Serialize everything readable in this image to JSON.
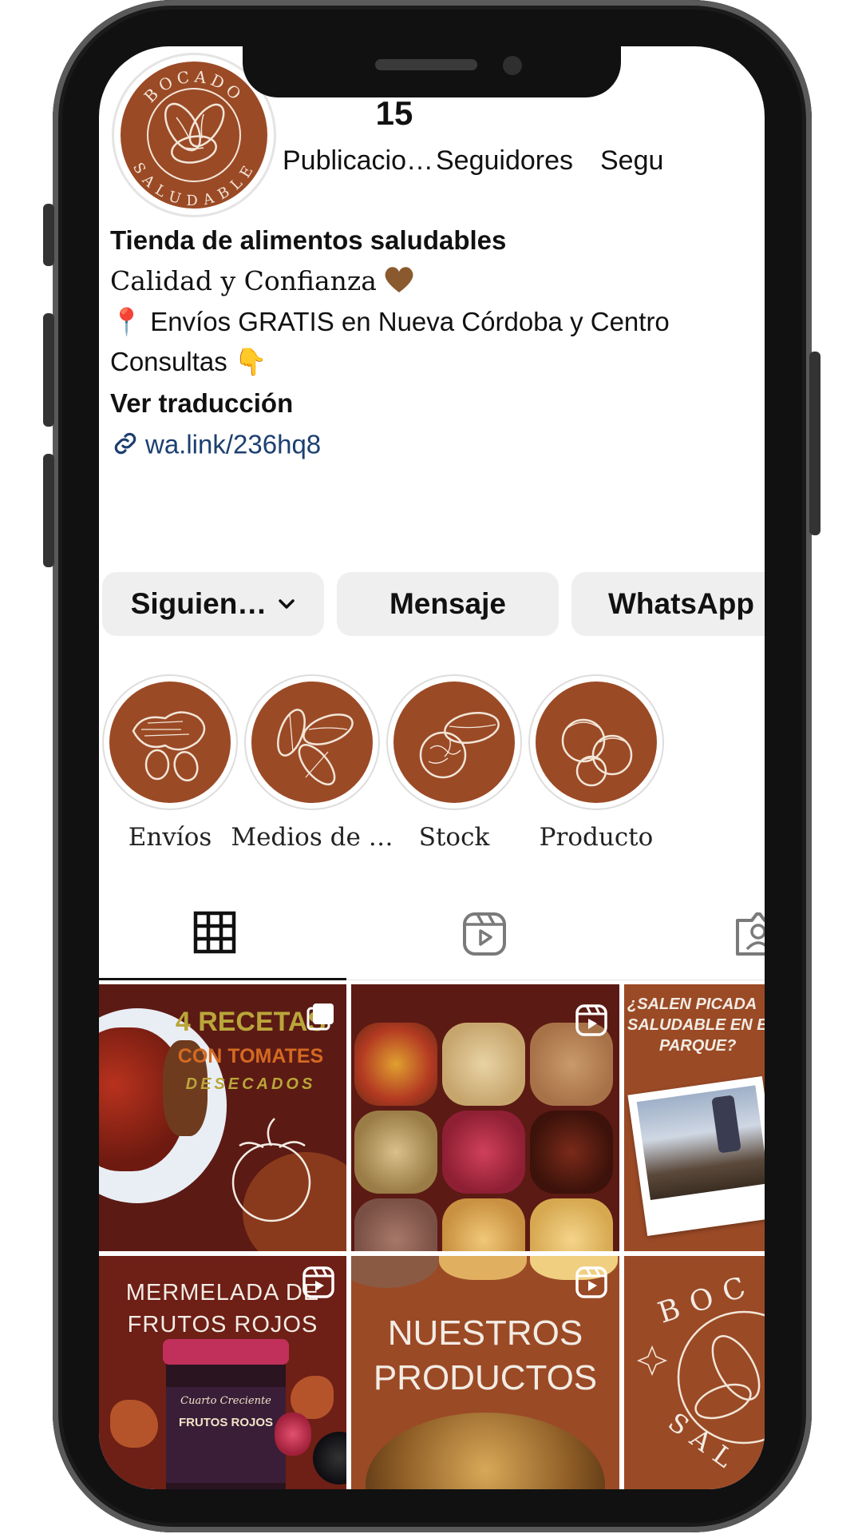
{
  "profile": {
    "avatar_text_top": "BOCADO",
    "avatar_text_bottom": "SALUDABLE",
    "posts_count": "15",
    "posts_label": "Publicacio…",
    "followers_label": "Seguidores",
    "following_label": "Segu"
  },
  "bio": {
    "category": "Tienda de alimentos saludables",
    "tagline": "Calidad y Confianza",
    "shipping": "📍 Envíos GRATIS en Nueva Córdoba y Centro",
    "contact": "Consultas 👇",
    "translate": "Ver traducción",
    "link": "wa.link/236hq8"
  },
  "actions": {
    "following": "Siguien…",
    "message": "Mensaje",
    "whatsapp": "WhatsApp"
  },
  "highlights": [
    {
      "label": "Envíos"
    },
    {
      "label": "Medios de …"
    },
    {
      "label": "Stock"
    },
    {
      "label": "Producto"
    }
  ],
  "posts": [
    {
      "title1": "4 RECETAS",
      "title2": "CON TOMATES",
      "title3": "DESECADOS"
    },
    {
      "title1": ""
    },
    {
      "title1": "¿SALEN PICADA",
      "title2": "SALUDABLE EN EL",
      "title3": "PARQUE?"
    },
    {
      "title1": "MERMELADA DE",
      "title2": "FRUTOS ROJOS",
      "jar_brand": "Cuarto Creciente",
      "jar_title": "FRUTOS ROJOS"
    },
    {
      "title1": "NUESTROS",
      "title2": "PRODUCTOS"
    },
    {
      "title1": "BOC",
      "title2": "SAL"
    }
  ],
  "colors": {
    "brand_brown": "#9b4a26",
    "dark_red": "#5c1a14",
    "link_blue": "#1c3f70",
    "button_gray": "#efefef"
  },
  "icons": [
    "grid-icon",
    "reels-icon",
    "tagged-icon",
    "link-icon",
    "chevron-down-icon",
    "reel-badge-icon",
    "carousel-icon"
  ]
}
